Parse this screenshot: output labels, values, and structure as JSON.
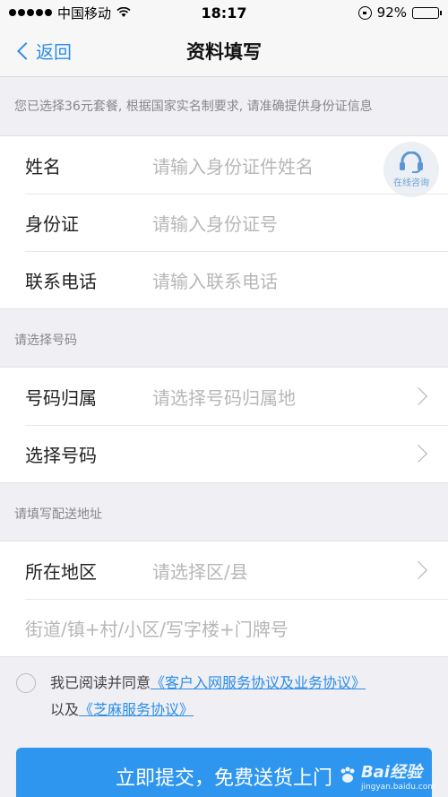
{
  "status_bar": {
    "carrier": "中国移动",
    "time": "18:17",
    "battery": "92%",
    "battery_level": 0.92
  },
  "nav": {
    "back_label": "返回",
    "title": "资料填写"
  },
  "notice": "您已选择36元套餐, 根据国家实名制要求, 请准确提供身份证信息",
  "identity": {
    "name_label": "姓名",
    "name_placeholder": "请输入身份证件姓名",
    "id_label": "身份证",
    "id_placeholder": "请输入身份证号",
    "phone_label": "联系电话",
    "phone_placeholder": "请输入联系电话"
  },
  "consult": {
    "label": "在线咨询",
    "icon": "headset-icon"
  },
  "number_section": {
    "title": "请选择号码",
    "region_label": "号码归属",
    "region_placeholder": "请选择号码归属地",
    "number_label": "选择号码"
  },
  "address_section": {
    "title": "请填写配送地址",
    "area_label": "所在地区",
    "area_placeholder": "请选择区/县",
    "street_placeholder": "街道/镇+村/小区/写字楼+门牌号"
  },
  "agreement": {
    "prefix": "我已阅读并同意",
    "link1": "《客户入网服务协议及业务协议》",
    "middle": "以及",
    "link2": "《芝麻服务协议》"
  },
  "submit_label": "立即提交，免费送货上门",
  "watermark": {
    "brand": "Bai",
    "brand_suffix": "经验",
    "url": "jingyan.baidu.com"
  },
  "colors": {
    "accent": "#2b8ee8",
    "button": "#2f96ef"
  }
}
